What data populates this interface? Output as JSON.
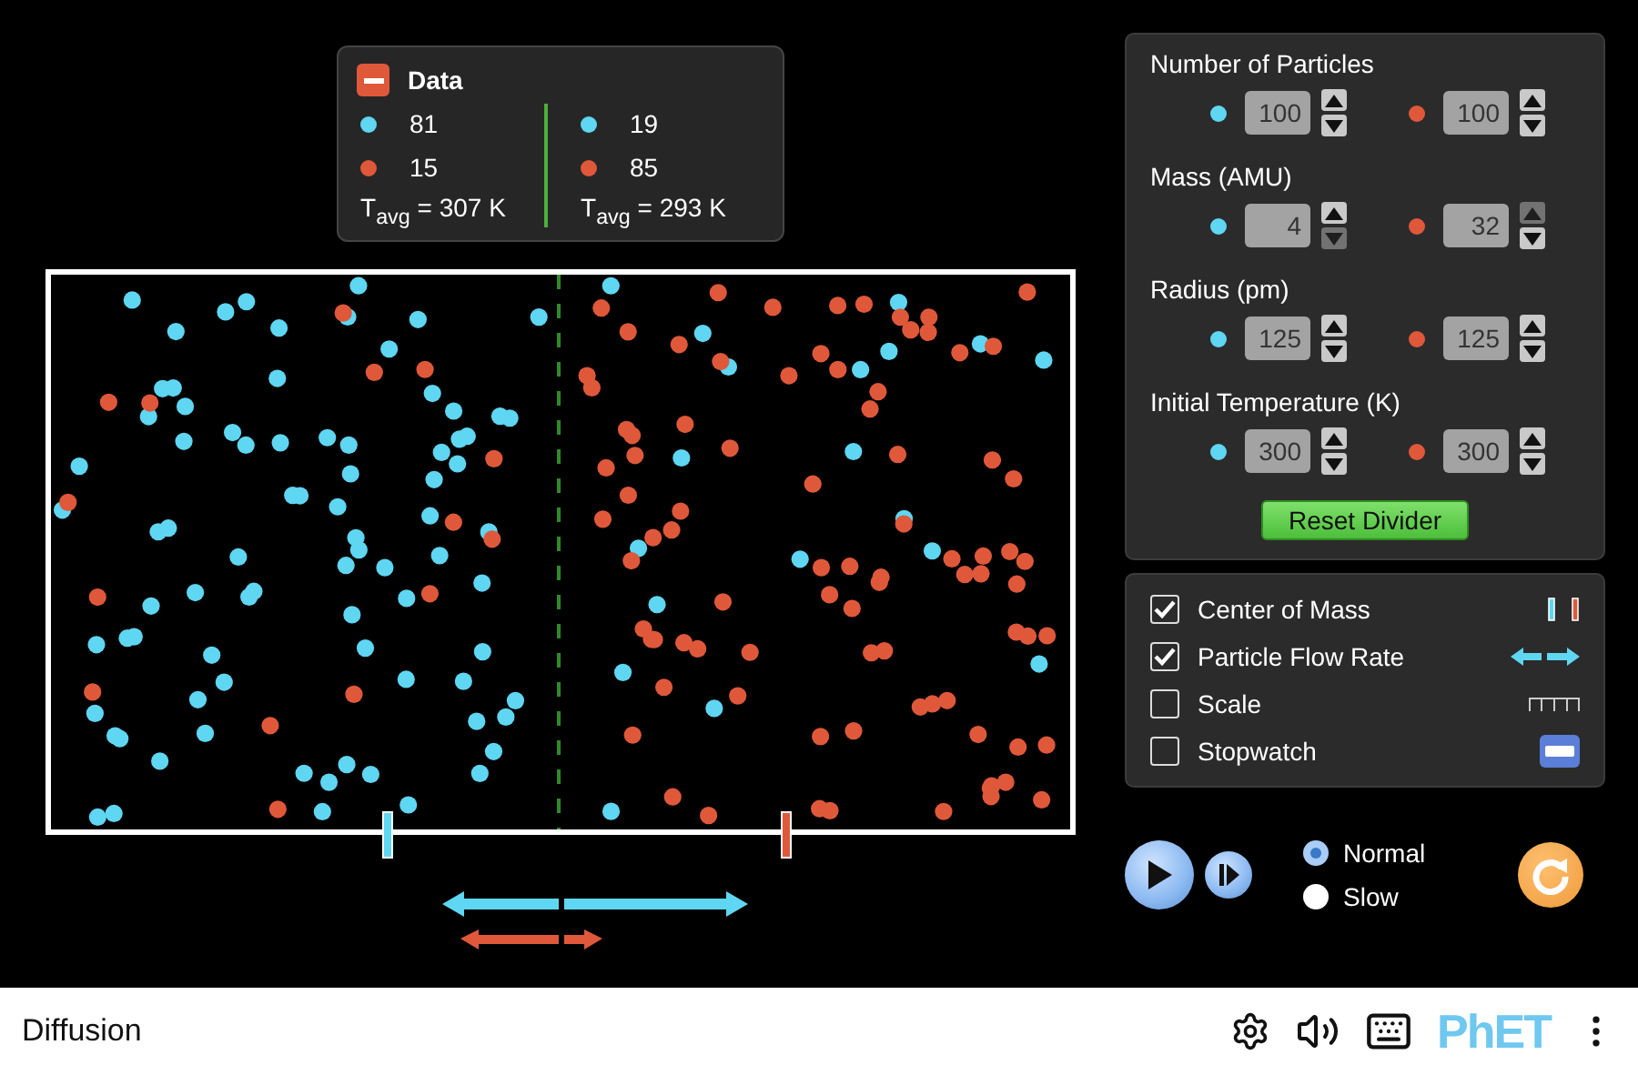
{
  "data_panel": {
    "title": "Data",
    "expanded": true,
    "sides": [
      {
        "rows": [
          {
            "color": "#5fd6f2",
            "count": "81"
          },
          {
            "color": "#e0583a",
            "count": "15"
          }
        ],
        "temperature": "T$_{avg}$ = 307 K"
      },
      {
        "rows": [
          {
            "color": "#5fd6f2",
            "count": "19"
          },
          {
            "color": "#e0583a",
            "count": "85"
          }
        ],
        "temperature": "T$_{avg}$ = 293 K"
      }
    ]
  },
  "controls": {
    "sections": [
      {
        "title": "Number of Particles",
        "spinners": [
          {
            "color": "#5fd6f2",
            "value": "100",
            "up_disabled": false,
            "down_disabled": false
          },
          {
            "color": "#e0583a",
            "value": "100",
            "up_disabled": false,
            "down_disabled": false
          }
        ]
      },
      {
        "title": "Mass (AMU)",
        "spinners": [
          {
            "color": "#5fd6f2",
            "value": "4",
            "up_disabled": false,
            "down_disabled": true
          },
          {
            "color": "#e0583a",
            "value": "32",
            "up_disabled": true,
            "down_disabled": false
          }
        ]
      },
      {
        "title": "Radius (pm)",
        "spinners": [
          {
            "color": "#5fd6f2",
            "value": "125",
            "up_disabled": false,
            "down_disabled": false
          },
          {
            "color": "#e0583a",
            "value": "125",
            "up_disabled": false,
            "down_disabled": false
          }
        ]
      },
      {
        "title": "Initial Temperature (K)",
        "spinners": [
          {
            "color": "#5fd6f2",
            "value": "300",
            "up_disabled": false,
            "down_disabled": false
          },
          {
            "color": "#e0583a",
            "value": "300",
            "up_disabled": false,
            "down_disabled": false
          }
        ]
      }
    ],
    "reset_button": "Reset Divider"
  },
  "options": [
    {
      "kind": "center_of_mass",
      "label": "Center of Mass",
      "checked": true
    },
    {
      "kind": "flow_rate",
      "label": "Particle Flow Rate",
      "checked": true
    },
    {
      "kind": "scale",
      "label": "Scale",
      "checked": false
    },
    {
      "kind": "stopwatch",
      "label": "Stopwatch",
      "checked": false
    }
  ],
  "playback": {
    "playing": false,
    "speeds": [
      {
        "label": "Normal",
        "selected": true
      },
      {
        "label": "Slow",
        "selected": false
      }
    ]
  },
  "nav_bar": {
    "title": "Diffusion",
    "logo": "PhET"
  }
}
